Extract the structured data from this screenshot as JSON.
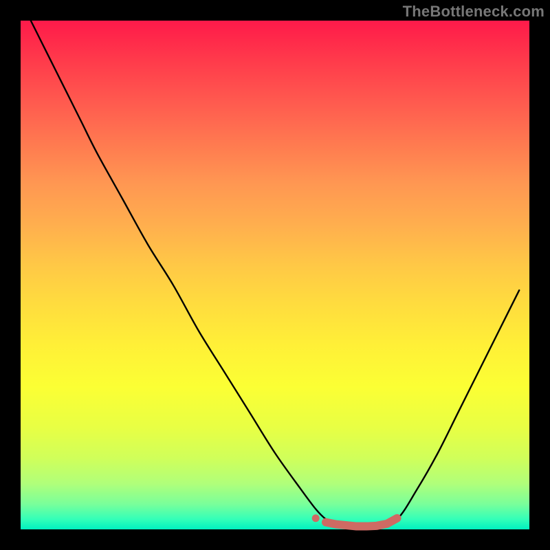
{
  "watermark": "TheBottleneck.com",
  "colors": {
    "frame": "#000000",
    "curve_stroke": "#000000",
    "marker_stroke": "#cf6a63",
    "marker_fill": "#cf6a63",
    "gradient_top": "#ff1a4a",
    "gradient_bottom": "#00f0c0"
  },
  "chart_data": {
    "type": "line",
    "title": "",
    "xlabel": "",
    "ylabel": "",
    "xlim": [
      0,
      100
    ],
    "ylim": [
      0,
      100
    ],
    "grid": false,
    "legend": false,
    "series": [
      {
        "name": "bottleneck-curve",
        "style": "line",
        "x": [
          2,
          4,
          6,
          8,
          10,
          12,
          15,
          20,
          25,
          30,
          35,
          40,
          45,
          50,
          55,
          58,
          60,
          62,
          65,
          70,
          74,
          78,
          82,
          86,
          90,
          94,
          98
        ],
        "y": [
          100,
          96,
          92,
          88,
          84,
          80,
          74,
          65,
          56,
          48,
          39,
          31,
          23,
          15,
          8,
          4,
          2,
          1,
          0.6,
          0.5,
          2,
          8,
          15,
          23,
          31,
          39,
          47
        ]
      },
      {
        "name": "sweet-spot",
        "style": "markers",
        "x": [
          58,
          60,
          62,
          64,
          66,
          68,
          70,
          72,
          74
        ],
        "y": [
          2.2,
          1.4,
          1.0,
          0.8,
          0.6,
          0.6,
          0.7,
          1.1,
          2.2
        ]
      }
    ],
    "annotations": []
  }
}
